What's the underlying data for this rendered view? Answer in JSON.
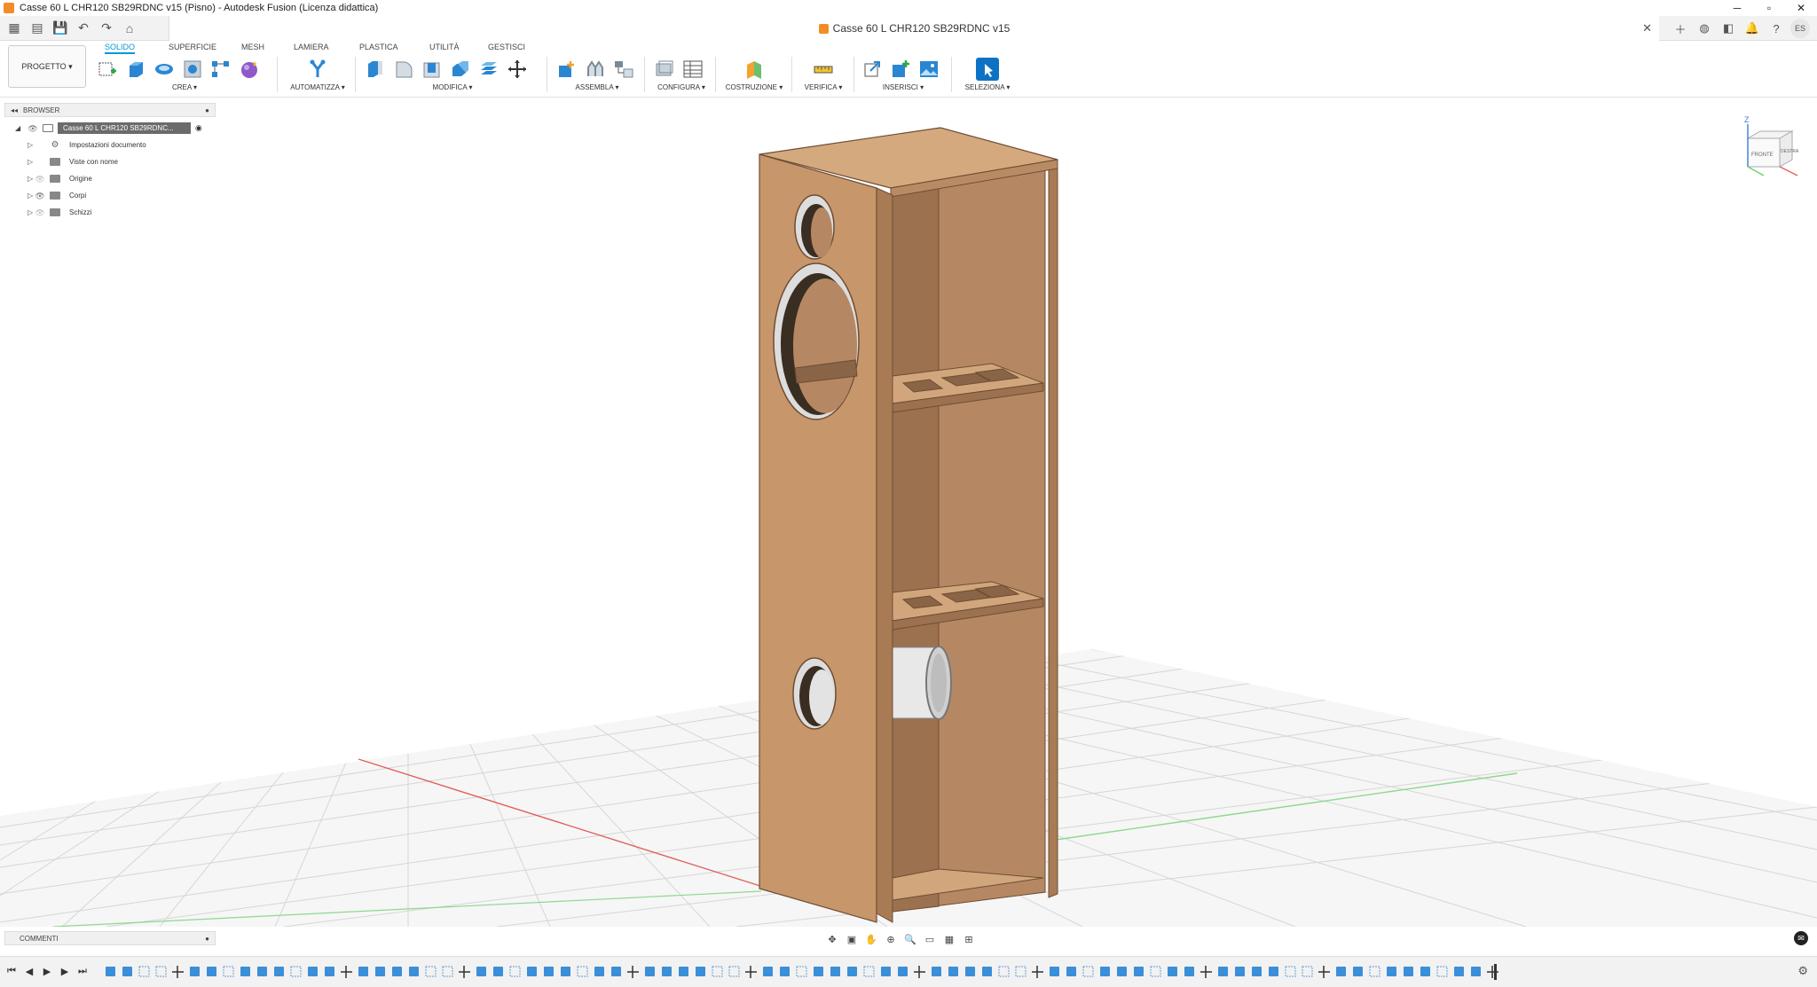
{
  "window": {
    "title": "Casse 60 L CHR120 SB29RDNC v15 (Pisno) - Autodesk Fusion (Licenza didattica)",
    "minimize": "─",
    "maximize": "▫",
    "close": "✕"
  },
  "document_tab": {
    "title": "Casse 60 L CHR120 SB29RDNC v15",
    "close": "✕"
  },
  "user": {
    "initials": "ES"
  },
  "toolbar": {
    "workspace_button": "PROGETTO ▾",
    "tabs": [
      "SOLIDO",
      "SUPERFICIE",
      "MESH",
      "LAMIERA",
      "PLASTICA",
      "UTILITÀ",
      "GESTISCI"
    ],
    "active_tab": "SOLIDO",
    "groups": {
      "crea": "CREA ▾",
      "automatizza": "AUTOMATIZZA ▾",
      "modifica": "MODIFICA ▾",
      "assembla": "ASSEMBLA ▾",
      "configura": "CONFIGURA ▾",
      "costruzione": "COSTRUZIONE ▾",
      "verifica": "VERIFICA ▾",
      "inserisci": "INSERISCI ▾",
      "seleziona": "SELEZIONA ▾"
    }
  },
  "browser": {
    "title": "BROWSER",
    "root": "Casse 60 L CHR120 SB29RDNC...",
    "items": [
      {
        "label": "Impostazioni documento",
        "icon": "gear-icon"
      },
      {
        "label": "Viste con nome",
        "icon": "folder-icon"
      },
      {
        "label": "Origine",
        "icon": "folder-icon"
      },
      {
        "label": "Corpi",
        "icon": "folder-icon"
      },
      {
        "label": "Schizzi",
        "icon": "folder-icon"
      }
    ]
  },
  "viewcube": {
    "face_right": "DESTRA",
    "face_front": "FRONTE",
    "axis_z": "Z"
  },
  "comments": {
    "title": "COMMENTI"
  },
  "colors": {
    "accent": "#0696d7",
    "mdf_front": "#c8966b",
    "mdf_side": "#b07f57",
    "mdf_top": "#d6aa80",
    "grid": "#d9d9d9",
    "x_axis": "#e06060",
    "y_axis": "#6fcf6f"
  }
}
